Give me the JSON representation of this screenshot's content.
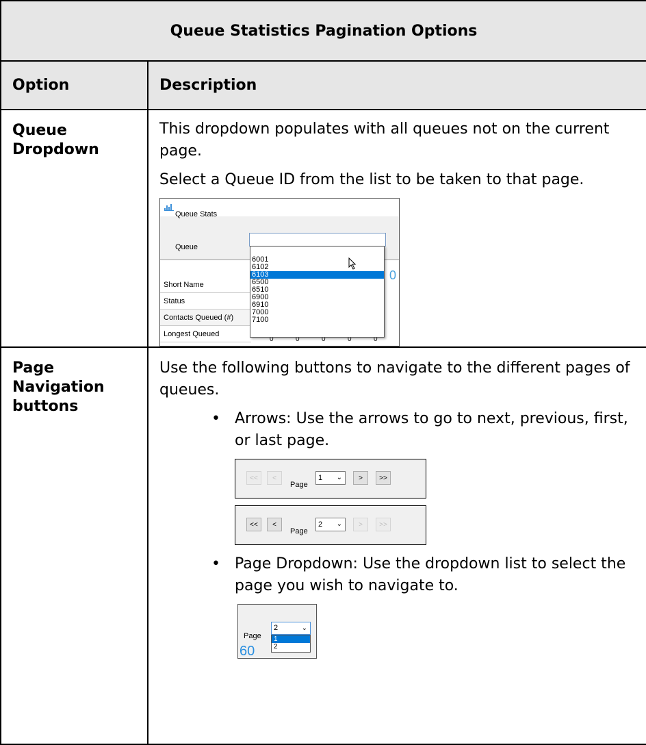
{
  "table": {
    "caption": "Queue Statistics Pagination Options",
    "headers": {
      "option": "Option",
      "description": "Description"
    },
    "rows": [
      {
        "option_line1": "Queue",
        "option_line2": "Dropdown",
        "para1": "This dropdown populates with all queues not on the current page.",
        "para2": "Select a Queue ID from the list to be taken to that page."
      },
      {
        "option_line1": "Page",
        "option_line2": "Navigation",
        "option_line3": "buttons",
        "para1": "Use the following buttons to navigate to the different pages of queues.",
        "bullet1": "Arrows: Use the arrows to go to next, previous, first, or last page.",
        "bullet2": "Page Dropdown: Use the dropdown list to select the page you wish to navigate to."
      }
    ]
  },
  "queue_stats_screenshot": {
    "window_title": "Queue Stats",
    "queue_label": "Queue",
    "dropdown_items": [
      "6001",
      "6102",
      "6103",
      "6500",
      "6510",
      "6900",
      "6910",
      "7000",
      "7100"
    ],
    "selected_item": "6103",
    "grid_rows": [
      "Short Name",
      "Status",
      "Contacts Queued (#)",
      "Longest Queued"
    ],
    "grid_values": [
      "0",
      "0",
      "0",
      "0",
      "0"
    ],
    "partial_digit": "0"
  },
  "pager_first": {
    "first": "<<",
    "prev": "<",
    "label": "Page",
    "value": "1",
    "next": ">",
    "last": ">>",
    "disabled": [
      "first",
      "prev"
    ]
  },
  "pager_last": {
    "first": "<<",
    "prev": "<",
    "label": "Page",
    "value": "2",
    "next": ">",
    "last": ">>",
    "disabled": [
      "next",
      "last"
    ]
  },
  "page_dropdown_screenshot": {
    "label": "Page",
    "value": "2",
    "options": [
      "1",
      "2"
    ],
    "selected_option": "1",
    "visible_value": "60"
  },
  "colors": {
    "header_bg": "#e6e6e6",
    "selection": "#0078d7"
  }
}
